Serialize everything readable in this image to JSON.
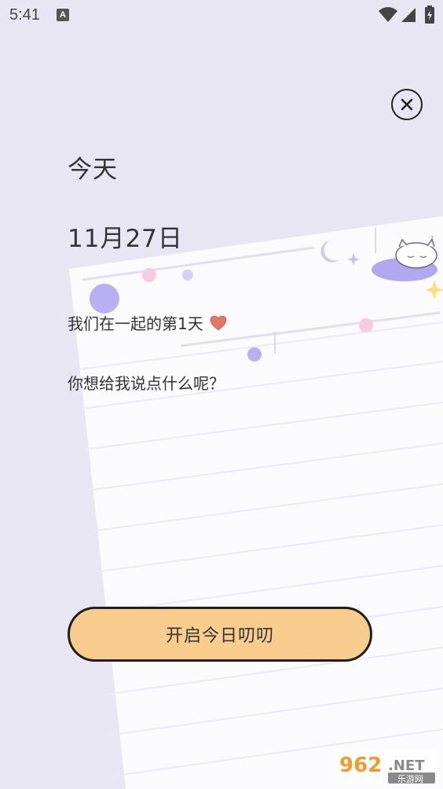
{
  "status_bar": {
    "time": "5:41",
    "notification_badge": "A",
    "icons": [
      "wifi-icon",
      "signal-icon",
      "battery-charging-icon"
    ]
  },
  "header": {
    "close_icon": "close-icon"
  },
  "content": {
    "title": "今天",
    "date": "11月27日",
    "together_text": "我们在一起的第1天",
    "prompt": "你想给我说点什么呢？"
  },
  "actions": {
    "start_label": "开启今日叨叨"
  },
  "watermark": {
    "logo_text": "962.NET",
    "sub_text": "乐游网"
  },
  "colors": {
    "background": "#e9e6f4",
    "paper": "#fbfafd",
    "button_fill": "#f7cc8c",
    "heart": "#e77566",
    "accent_purple": "#a99ef0"
  }
}
